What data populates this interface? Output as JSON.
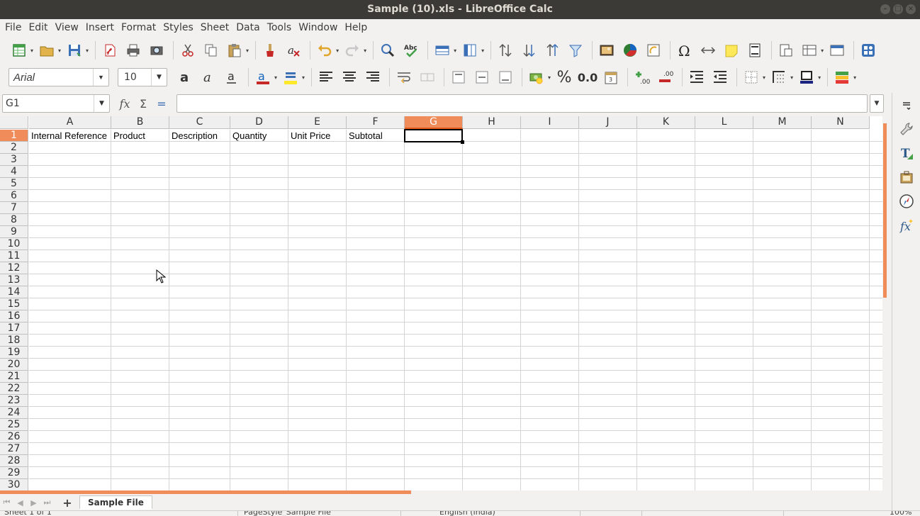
{
  "window": {
    "title": "Sample (10).xls - LibreOffice Calc"
  },
  "menu": [
    "File",
    "Edit",
    "View",
    "Insert",
    "Format",
    "Styles",
    "Sheet",
    "Data",
    "Tools",
    "Window",
    "Help"
  ],
  "format": {
    "font_name": "Arial",
    "font_size": "10",
    "percent_symbol": "%",
    "number_format": "0.0"
  },
  "formula_bar": {
    "cell_ref": "G1",
    "content": ""
  },
  "grid": {
    "columns": [
      "A",
      "B",
      "C",
      "D",
      "E",
      "F",
      "G",
      "H",
      "I",
      "J",
      "K",
      "L",
      "M",
      "N"
    ],
    "selected_column": "G",
    "rows": [
      "1",
      "2",
      "3",
      "4",
      "5",
      "6",
      "7",
      "8",
      "9",
      "10",
      "11",
      "12",
      "13",
      "14",
      "15",
      "16",
      "17",
      "18",
      "19",
      "20",
      "21",
      "22",
      "23",
      "24",
      "25",
      "26",
      "27",
      "28",
      "29",
      "30"
    ],
    "selected_row": "1",
    "row1": [
      "Internal Reference",
      "Product",
      "Description",
      "Quantity",
      "Unit Price",
      "Subtotal"
    ]
  },
  "sheets": {
    "tabs": [
      "Sample File"
    ],
    "active": "Sample File"
  },
  "status": {
    "sheet_pos": "Sheet 1 of 1",
    "page_style": "PageStyle_Sample File",
    "language": "English (India)",
    "zoom": "100%"
  },
  "colors": {
    "accent": "#f08b5a",
    "titlebar": "#3b3a36"
  }
}
